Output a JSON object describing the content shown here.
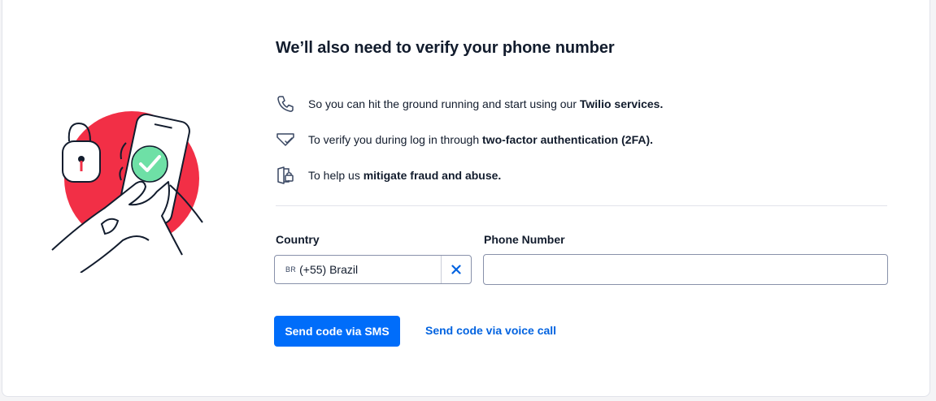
{
  "title": "We’ll also need to verify your phone number",
  "reasons": [
    {
      "icon": "phone-icon",
      "text": "So you can hit the ground running and start using our ",
      "bold": "Twilio services."
    },
    {
      "icon": "shield-check-icon",
      "text": "To verify you during log in through ",
      "bold": "two-factor authentication (2FA)."
    },
    {
      "icon": "fraud-lock-icon",
      "text": "To help us ",
      "bold": "mitigate fraud and abuse."
    }
  ],
  "form": {
    "country_label": "Country",
    "country_code": "BR",
    "country_value": "(+55) Brazil",
    "phone_label": "Phone Number",
    "phone_value": ""
  },
  "actions": {
    "sms_label": "Send code via SMS",
    "voice_label": "Send code via voice call"
  },
  "colors": {
    "accent": "#006dfa",
    "link": "#0263e0",
    "illustration_red": "#f22f46",
    "check_green": "#6ee0a6"
  }
}
